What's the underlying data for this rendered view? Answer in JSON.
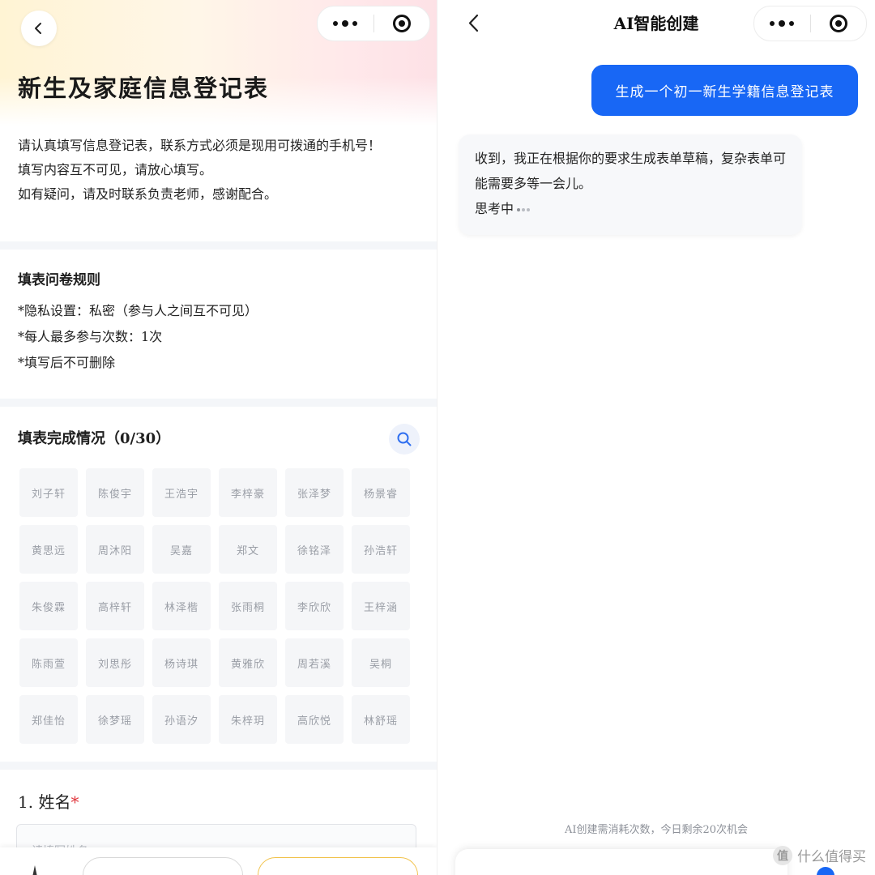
{
  "form_screen": {
    "title": "新生及家庭信息登记表",
    "intro": [
      "请认真填写信息登记表，联系方式必须是现用可拨通的手机号！",
      "填写内容互不可见，请放心填写。",
      "如有疑问，请及时联系负责老师，感谢配合。"
    ],
    "rules": {
      "heading": "填表问卷规则",
      "items": [
        "*隐私设置：私密（参与人之间互不可见）",
        "*每人最多参与次数：1次",
        "*填写后不可删除"
      ]
    },
    "completion": {
      "heading": "填表完成情况（0/30）",
      "names": [
        "刘子轩",
        "陈俊宇",
        "王浩宇",
        "李梓豪",
        "张泽梦",
        "杨景睿",
        "黄思远",
        "周沐阳",
        "吴嘉",
        "郑文",
        "徐铭泽",
        "孙浩轩",
        "朱俊霖",
        "高梓轩",
        "林泽楷",
        "张雨桐",
        "李欣欣",
        "王梓涵",
        "陈雨萱",
        "刘思彤",
        "杨诗琪",
        "黄雅欣",
        "周若溪",
        "吴桐",
        "郑佳怡",
        "徐梦瑶",
        "孙语汐",
        "朱梓玥",
        "高欣悦",
        "林舒瑶"
      ]
    },
    "question": {
      "label": "1. 姓名",
      "required_mark": "*",
      "placeholder": "请填写姓名"
    }
  },
  "chat_screen": {
    "title": "AI智能创建",
    "user_message": "生成一个初一新生学籍信息登记表",
    "ai_message": {
      "text": "收到，我正在根据你的要求生成表单草稿，复杂表单可能需要多等一会儿。",
      "status": "思考中"
    },
    "notice": "AI创建需消耗次数，今日剩余20次机会"
  },
  "watermark": {
    "logo": "值",
    "text": "什么值得买"
  },
  "colors": {
    "primary_blue": "#1867f5",
    "required_red": "#e0343b",
    "accent_yellow": "#f1c24a"
  },
  "icons": {
    "back": "chevron-left-icon",
    "more": "more-dots-icon",
    "close_miniprogram": "target-circle-icon",
    "search": "search-icon"
  }
}
